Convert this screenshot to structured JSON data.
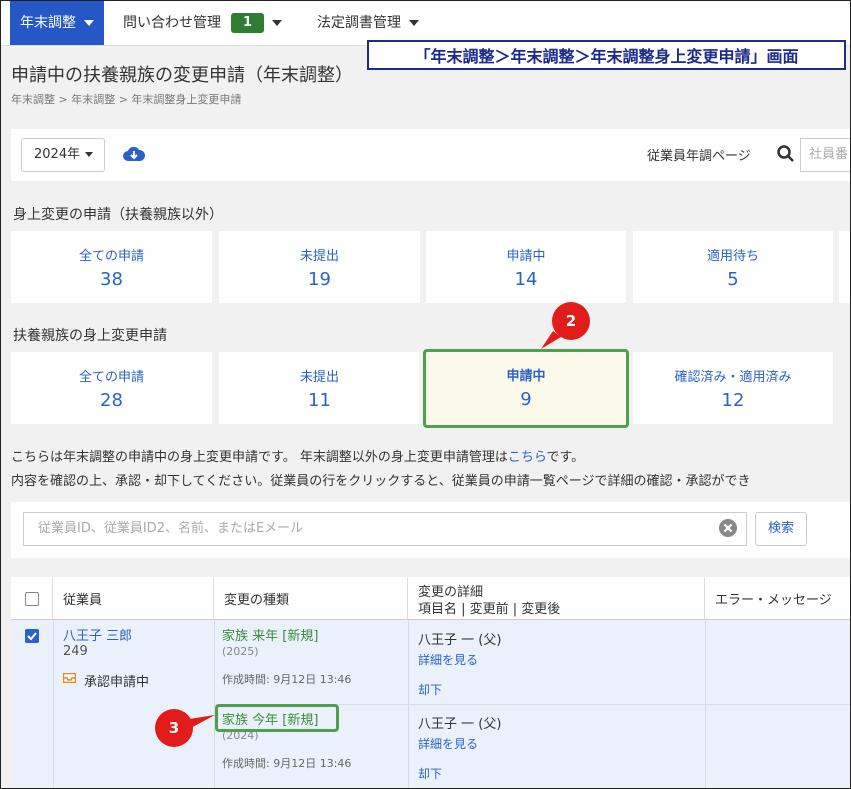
{
  "nav": {
    "items": [
      {
        "label": "年末調整"
      },
      {
        "label": "問い合わせ管理",
        "badge": "1"
      },
      {
        "label": "法定調書管理"
      }
    ]
  },
  "callout": "「年末調整＞年末調整＞年末調整身上変更申請」画面",
  "page": {
    "title": "申請中の扶養親族の変更申請（年末調整）",
    "breadcrumb": "年末調整 > 年末調整 > 年末調整身上変更申請"
  },
  "toolbar": {
    "year": "2024年",
    "employee_page_label": "従業員年調ページ",
    "employee_search_placeholder": "社員番"
  },
  "section1": {
    "title": "身上変更の申請（扶養親族以外）",
    "cards": [
      {
        "label": "全ての申請",
        "count": "38"
      },
      {
        "label": "未提出",
        "count": "19"
      },
      {
        "label": "申請中",
        "count": "14"
      },
      {
        "label": "適用待ち",
        "count": "5"
      }
    ]
  },
  "section2": {
    "title": "扶養親族の身上変更申請",
    "cards": [
      {
        "label": "全ての申請",
        "count": "28"
      },
      {
        "label": "未提出",
        "count": "11"
      },
      {
        "label": "申請中",
        "count": "9"
      },
      {
        "label": "確認済み・適用済み",
        "count": "12"
      }
    ]
  },
  "info": {
    "line1_prefix": "こちらは年末調整の申請中の身上変更申請です。 年末調整以外の身上変更申請管理は",
    "line1_link": "こちら",
    "line1_suffix": "です。",
    "line2": "内容を確認の上、承認・却下してください。従業員の行をクリックすると、従業員の申請一覧ページで詳細の確認・承認ができ"
  },
  "filter": {
    "placeholder": "従業員ID、従業員ID2、名前、またはEメール",
    "search_label": "検索"
  },
  "table": {
    "headers": {
      "employee": "従業員",
      "change_type": "変更の種類",
      "detail_line1": "変更の詳細",
      "detail_line2": "項目名 | 変更前 | 変更後",
      "error": "エラー・メッセージ"
    },
    "row": {
      "employee_name": "八王子 三郎",
      "employee_id": "249",
      "status": "承認申請中",
      "changes": [
        {
          "type": "家族 来年 [新規]",
          "year": "(2025)",
          "created": "作成時間: 9月12日 13:46",
          "name": "八王子 一 (父)",
          "view": "詳細を見る",
          "reject": "却下"
        },
        {
          "type": "家族 今年 [新規]",
          "year": "(2024)",
          "created": "作成時間: 9月12日 13:46",
          "name": "八王子 一 (父)",
          "view": "詳細を見る",
          "reject": "却下"
        }
      ]
    }
  },
  "markers": [
    "2",
    "3"
  ]
}
